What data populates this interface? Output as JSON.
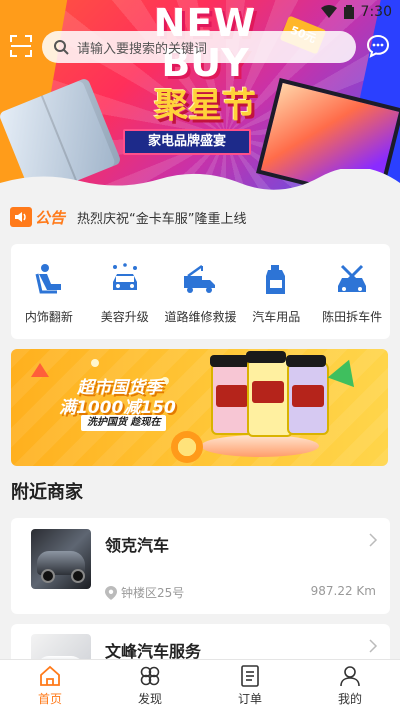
{
  "status_bar": {
    "time": "7:30"
  },
  "search": {
    "placeholder": "请输入要搜索的关键词"
  },
  "hero": {
    "title_line1": "NEW",
    "title_line2": "BUY",
    "title_cn": "聚星节",
    "subtitle": "家电品牌盛宴",
    "coupon": "50元"
  },
  "notice": {
    "badge": "公告",
    "message": "热烈庆祝“金卡车服”隆重上线"
  },
  "services": [
    {
      "label": "内饰翻新",
      "icon": "car-seat-icon"
    },
    {
      "label": "美容升级",
      "icon": "car-wash-icon"
    },
    {
      "label": "道路维修救援",
      "icon": "tow-truck-icon"
    },
    {
      "label": "汽车用品",
      "icon": "oil-bottle-icon"
    },
    {
      "label": "陈田拆车件",
      "icon": "car-parts-icon"
    }
  ],
  "promo": {
    "line1": "超市国货季",
    "line2": "满1000减150",
    "line3": "洗护国货 趁现在"
  },
  "nearby": {
    "title": "附近商家",
    "merchants": [
      {
        "name": "领克汽车",
        "address": "钟楼区25号",
        "distance": "987.22 Km"
      },
      {
        "name": "文峰汽车服务",
        "address": "",
        "distance": ""
      }
    ]
  },
  "tabs": [
    {
      "label": "首页",
      "icon": "home-icon",
      "active": true
    },
    {
      "label": "发现",
      "icon": "discover-icon",
      "active": false
    },
    {
      "label": "订单",
      "icon": "order-icon",
      "active": false
    },
    {
      "label": "我的",
      "icon": "profile-icon",
      "active": false
    }
  ],
  "colors": {
    "accent": "#ff7a1a",
    "icon_blue": "#2d74d6"
  }
}
